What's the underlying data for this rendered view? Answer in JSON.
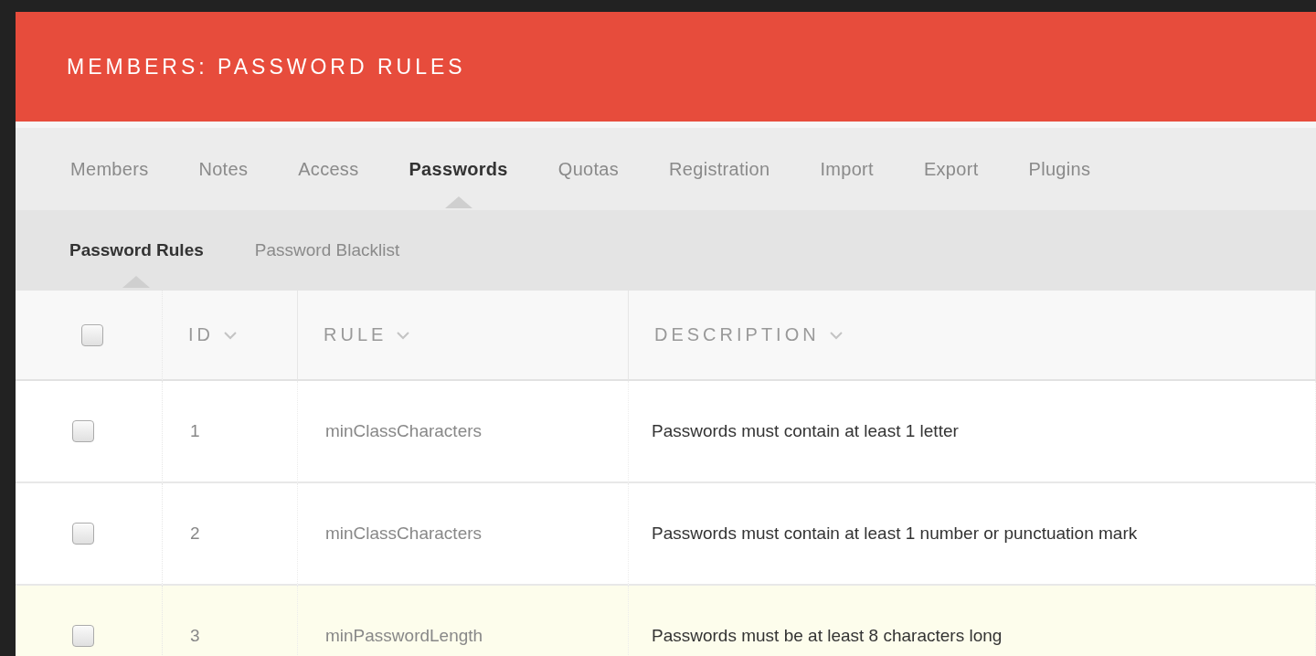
{
  "header": {
    "title": "MEMBERS: PASSWORD RULES"
  },
  "tabs": [
    {
      "label": "Members",
      "selected": false
    },
    {
      "label": "Notes",
      "selected": false
    },
    {
      "label": "Access",
      "selected": false
    },
    {
      "label": "Passwords",
      "selected": true
    },
    {
      "label": "Quotas",
      "selected": false
    },
    {
      "label": "Registration",
      "selected": false
    },
    {
      "label": "Import",
      "selected": false
    },
    {
      "label": "Export",
      "selected": false
    },
    {
      "label": "Plugins",
      "selected": false
    }
  ],
  "subtabs": [
    {
      "label": "Password Rules",
      "selected": true
    },
    {
      "label": "Password Blacklist",
      "selected": false
    }
  ],
  "table": {
    "select_all": {
      "checked": false
    },
    "columns": [
      "ID",
      "RULE",
      "DESCRIPTION"
    ],
    "rows": [
      {
        "checked": false,
        "highlighted": false,
        "id": "1",
        "rule": "minClassCharacters",
        "description": "Passwords must contain at least 1 letter"
      },
      {
        "checked": false,
        "highlighted": false,
        "id": "2",
        "rule": "minClassCharacters",
        "description": "Passwords must contain at least 1 number or punctuation mark"
      },
      {
        "checked": false,
        "highlighted": true,
        "id": "3",
        "rule": "minPasswordLength",
        "description": "Passwords must be at least 8 characters long"
      }
    ]
  }
}
